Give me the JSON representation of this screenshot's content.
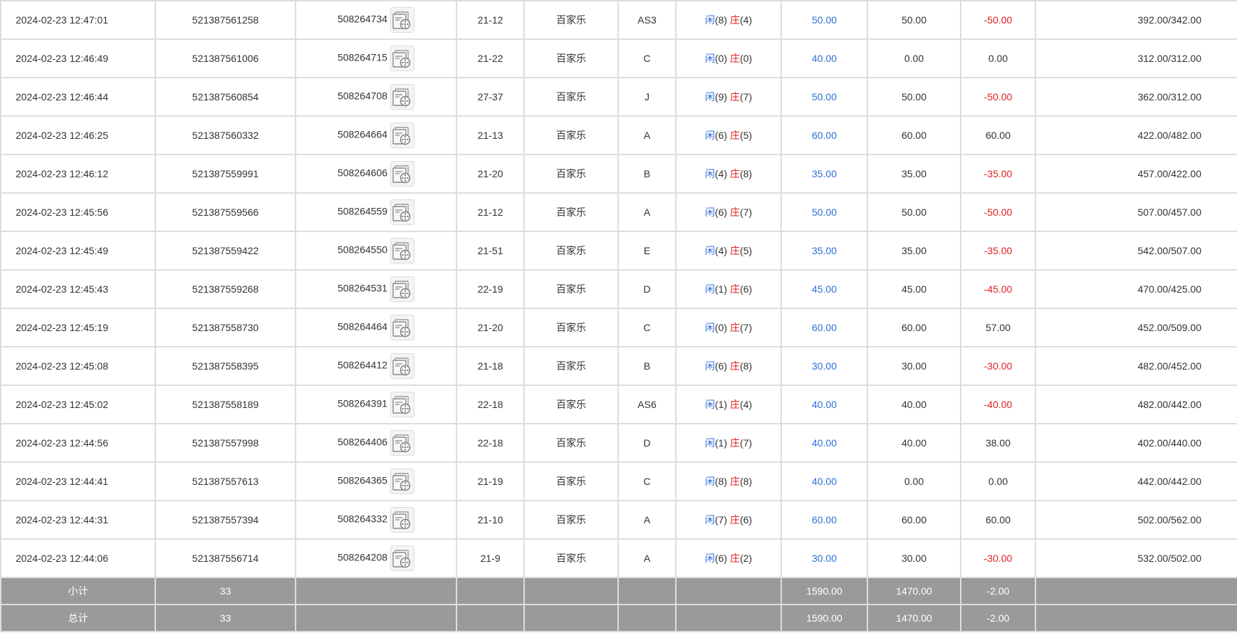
{
  "colors": {
    "player": "#2f6fd6",
    "banker": "#e02020",
    "summary_bg": "#9a9a9a",
    "grid": "#dddddd"
  },
  "labels": {
    "player": "闲",
    "banker": "庄"
  },
  "icon_name": "video-replay-icon",
  "rows": [
    {
      "time": "2024-02-23 12:47:01",
      "bet_no": "521387561258",
      "game_no": "508264734",
      "table": "21-12",
      "game": "百家乐",
      "bet_type": "AS3",
      "player_pts": "(8)",
      "banker_pts": "(4)",
      "bet_amount": "50.00",
      "valid_bet": "50.00",
      "win_loss": "-50.00",
      "win_loss_neg": true,
      "balance": "392.00/342.00"
    },
    {
      "time": "2024-02-23 12:46:49",
      "bet_no": "521387561006",
      "game_no": "508264715",
      "table": "21-22",
      "game": "百家乐",
      "bet_type": "C",
      "player_pts": "(0)",
      "banker_pts": "(0)",
      "bet_amount": "40.00",
      "valid_bet": "0.00",
      "win_loss": "0.00",
      "win_loss_neg": false,
      "balance": "312.00/312.00"
    },
    {
      "time": "2024-02-23 12:46:44",
      "bet_no": "521387560854",
      "game_no": "508264708",
      "table": "27-37",
      "game": "百家乐",
      "bet_type": "J",
      "player_pts": "(9)",
      "banker_pts": "(7)",
      "bet_amount": "50.00",
      "valid_bet": "50.00",
      "win_loss": "-50.00",
      "win_loss_neg": true,
      "balance": "362.00/312.00"
    },
    {
      "time": "2024-02-23 12:46:25",
      "bet_no": "521387560332",
      "game_no": "508264664",
      "table": "21-13",
      "game": "百家乐",
      "bet_type": "A",
      "player_pts": "(6)",
      "banker_pts": "(5)",
      "bet_amount": "60.00",
      "valid_bet": "60.00",
      "win_loss": "60.00",
      "win_loss_neg": false,
      "balance": "422.00/482.00"
    },
    {
      "time": "2024-02-23 12:46:12",
      "bet_no": "521387559991",
      "game_no": "508264606",
      "table": "21-20",
      "game": "百家乐",
      "bet_type": "B",
      "player_pts": "(4)",
      "banker_pts": "(8)",
      "bet_amount": "35.00",
      "valid_bet": "35.00",
      "win_loss": "-35.00",
      "win_loss_neg": true,
      "balance": "457.00/422.00"
    },
    {
      "time": "2024-02-23 12:45:56",
      "bet_no": "521387559566",
      "game_no": "508264559",
      "table": "21-12",
      "game": "百家乐",
      "bet_type": "A",
      "player_pts": "(6)",
      "banker_pts": "(7)",
      "bet_amount": "50.00",
      "valid_bet": "50.00",
      "win_loss": "-50.00",
      "win_loss_neg": true,
      "balance": "507.00/457.00"
    },
    {
      "time": "2024-02-23 12:45:49",
      "bet_no": "521387559422",
      "game_no": "508264550",
      "table": "21-51",
      "game": "百家乐",
      "bet_type": "E",
      "player_pts": "(4)",
      "banker_pts": "(5)",
      "bet_amount": "35.00",
      "valid_bet": "35.00",
      "win_loss": "-35.00",
      "win_loss_neg": true,
      "balance": "542.00/507.00"
    },
    {
      "time": "2024-02-23 12:45:43",
      "bet_no": "521387559268",
      "game_no": "508264531",
      "table": "22-19",
      "game": "百家乐",
      "bet_type": "D",
      "player_pts": "(1)",
      "banker_pts": "(6)",
      "bet_amount": "45.00",
      "valid_bet": "45.00",
      "win_loss": "-45.00",
      "win_loss_neg": true,
      "balance": "470.00/425.00"
    },
    {
      "time": "2024-02-23 12:45:19",
      "bet_no": "521387558730",
      "game_no": "508264464",
      "table": "21-20",
      "game": "百家乐",
      "bet_type": "C",
      "player_pts": "(0)",
      "banker_pts": "(7)",
      "bet_amount": "60.00",
      "valid_bet": "60.00",
      "win_loss": "57.00",
      "win_loss_neg": false,
      "balance": "452.00/509.00"
    },
    {
      "time": "2024-02-23 12:45:08",
      "bet_no": "521387558395",
      "game_no": "508264412",
      "table": "21-18",
      "game": "百家乐",
      "bet_type": "B",
      "player_pts": "(6)",
      "banker_pts": "(8)",
      "bet_amount": "30.00",
      "valid_bet": "30.00",
      "win_loss": "-30.00",
      "win_loss_neg": true,
      "balance": "482.00/452.00"
    },
    {
      "time": "2024-02-23 12:45:02",
      "bet_no": "521387558189",
      "game_no": "508264391",
      "table": "22-18",
      "game": "百家乐",
      "bet_type": "AS6",
      "player_pts": "(1)",
      "banker_pts": "(4)",
      "bet_amount": "40.00",
      "valid_bet": "40.00",
      "win_loss": "-40.00",
      "win_loss_neg": true,
      "balance": "482.00/442.00"
    },
    {
      "time": "2024-02-23 12:44:56",
      "bet_no": "521387557998",
      "game_no": "508264406",
      "table": "22-18",
      "game": "百家乐",
      "bet_type": "D",
      "player_pts": "(1)",
      "banker_pts": "(7)",
      "bet_amount": "40.00",
      "valid_bet": "40.00",
      "win_loss": "38.00",
      "win_loss_neg": false,
      "balance": "402.00/440.00"
    },
    {
      "time": "2024-02-23 12:44:41",
      "bet_no": "521387557613",
      "game_no": "508264365",
      "table": "21-19",
      "game": "百家乐",
      "bet_type": "C",
      "player_pts": "(8)",
      "banker_pts": "(8)",
      "bet_amount": "40.00",
      "valid_bet": "0.00",
      "win_loss": "0.00",
      "win_loss_neg": false,
      "balance": "442.00/442.00"
    },
    {
      "time": "2024-02-23 12:44:31",
      "bet_no": "521387557394",
      "game_no": "508264332",
      "table": "21-10",
      "game": "百家乐",
      "bet_type": "A",
      "player_pts": "(7)",
      "banker_pts": "(6)",
      "bet_amount": "60.00",
      "valid_bet": "60.00",
      "win_loss": "60.00",
      "win_loss_neg": false,
      "balance": "502.00/562.00"
    },
    {
      "time": "2024-02-23 12:44:06",
      "bet_no": "521387556714",
      "game_no": "508264208",
      "table": "21-9",
      "game": "百家乐",
      "bet_type": "A",
      "player_pts": "(6)",
      "banker_pts": "(2)",
      "bet_amount": "30.00",
      "valid_bet": "30.00",
      "win_loss": "-30.00",
      "win_loss_neg": true,
      "balance": "532.00/502.00"
    }
  ],
  "subtotal": {
    "label": "小计",
    "count": "33",
    "bet_amount": "1590.00",
    "valid_bet": "1470.00",
    "win_loss": "-2.00"
  },
  "total": {
    "label": "总计",
    "count": "33",
    "bet_amount": "1590.00",
    "valid_bet": "1470.00",
    "win_loss": "-2.00"
  }
}
